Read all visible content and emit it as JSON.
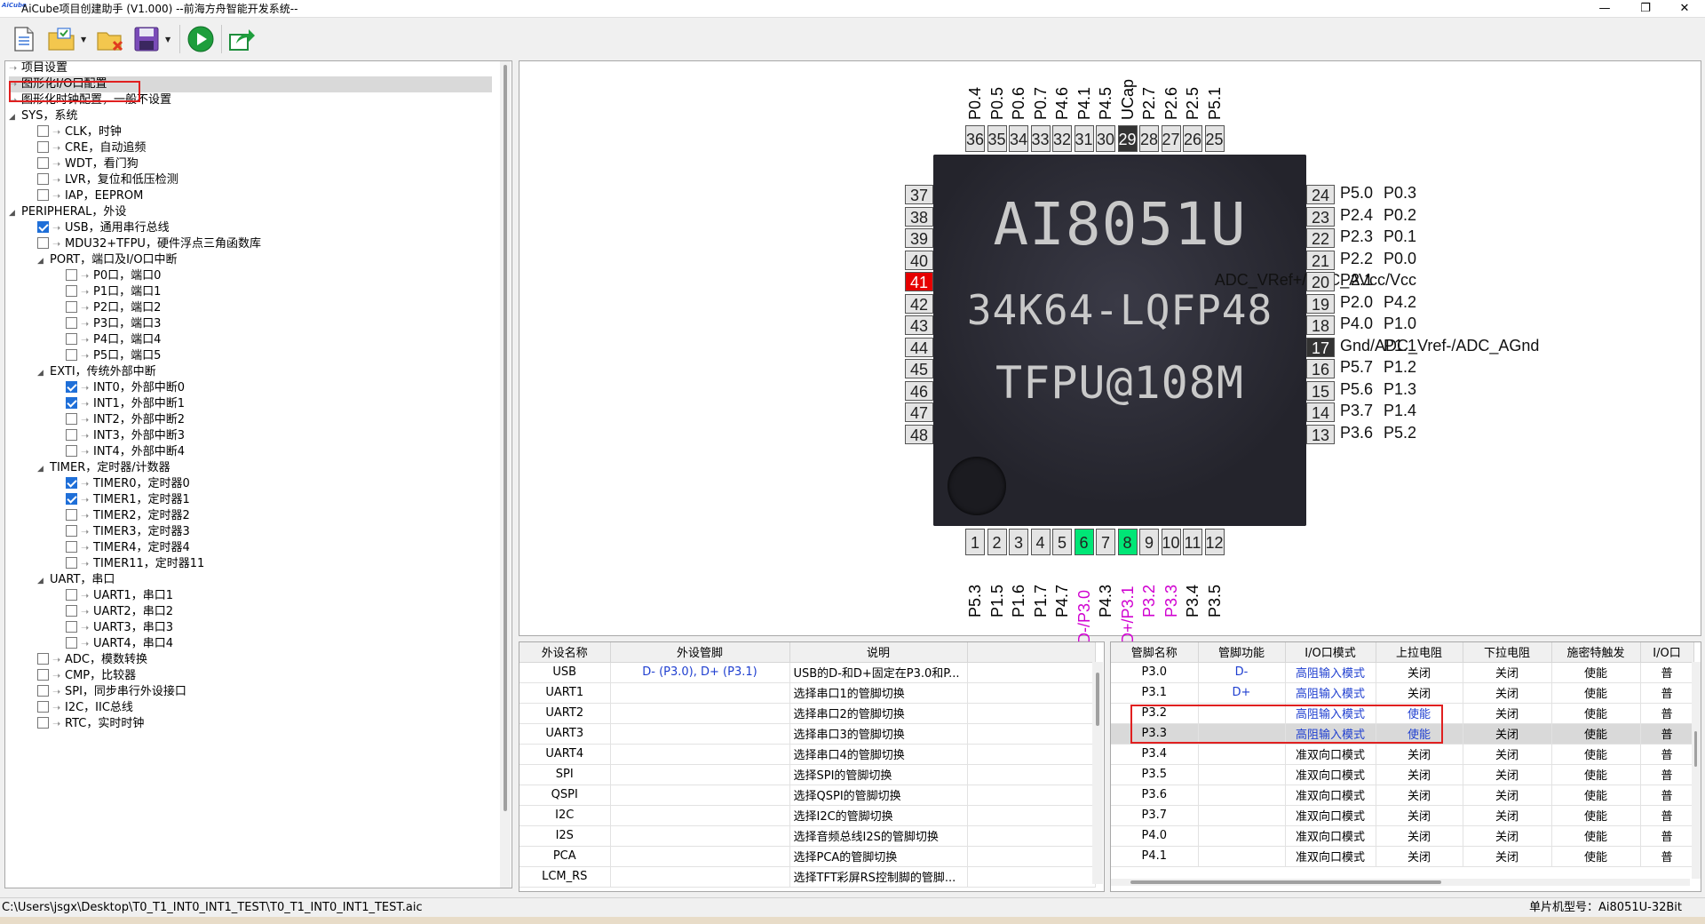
{
  "window": {
    "title": "AiCube项目创建助手 (V1.000) --前海方舟智能开发系统--",
    "logo_text": "AiCube",
    "minimize": "—",
    "restore": "❐",
    "close": "✕"
  },
  "toolbar": {
    "buttons": [
      "new-project",
      "open-project",
      "close-project",
      "save-project",
      "run",
      "export"
    ]
  },
  "tree": {
    "items": [
      {
        "label": "项目设置",
        "level": 0,
        "type": "leaf"
      },
      {
        "label": "图形化I/O口配置",
        "level": 0,
        "type": "leaf",
        "selected": true
      },
      {
        "label": "图形化时钟配置，一般不设置",
        "level": 0,
        "type": "leaf"
      },
      {
        "label": "SYS，系统",
        "level": 0,
        "type": "group"
      },
      {
        "label": "CLK，时钟",
        "level": 1,
        "type": "check",
        "checked": false
      },
      {
        "label": "CRE，自动追频",
        "level": 1,
        "type": "check",
        "checked": false
      },
      {
        "label": "WDT，看门狗",
        "level": 1,
        "type": "check",
        "checked": false
      },
      {
        "label": "LVR，复位和低压检测",
        "level": 1,
        "type": "check",
        "checked": false
      },
      {
        "label": "IAP，EEPROM",
        "level": 1,
        "type": "check",
        "checked": false
      },
      {
        "label": "PERIPHERAL，外设",
        "level": 0,
        "type": "group"
      },
      {
        "label": "USB，通用串行总线",
        "level": 1,
        "type": "check",
        "checked": true
      },
      {
        "label": "MDU32+TFPU，硬件浮点三角函数库",
        "level": 1,
        "type": "check",
        "checked": false
      },
      {
        "label": "PORT，端口及I/O口中断",
        "level": 1,
        "type": "group"
      },
      {
        "label": "P0口，端口0",
        "level": 2,
        "type": "check",
        "checked": false
      },
      {
        "label": "P1口，端口1",
        "level": 2,
        "type": "check",
        "checked": false
      },
      {
        "label": "P2口，端口2",
        "level": 2,
        "type": "check",
        "checked": false
      },
      {
        "label": "P3口，端口3",
        "level": 2,
        "type": "check",
        "checked": false
      },
      {
        "label": "P4口，端口4",
        "level": 2,
        "type": "check",
        "checked": false
      },
      {
        "label": "P5口，端口5",
        "level": 2,
        "type": "check",
        "checked": false
      },
      {
        "label": "EXTI，传统外部中断",
        "level": 1,
        "type": "group"
      },
      {
        "label": "INT0，外部中断0",
        "level": 2,
        "type": "check",
        "checked": true
      },
      {
        "label": "INT1，外部中断1",
        "level": 2,
        "type": "check",
        "checked": true
      },
      {
        "label": "INT2，外部中断2",
        "level": 2,
        "type": "check",
        "checked": false
      },
      {
        "label": "INT3，外部中断3",
        "level": 2,
        "type": "check",
        "checked": false
      },
      {
        "label": "INT4，外部中断4",
        "level": 2,
        "type": "check",
        "checked": false
      },
      {
        "label": "TIMER，定时器/计数器",
        "level": 1,
        "type": "group"
      },
      {
        "label": "TIMER0，定时器0",
        "level": 2,
        "type": "check",
        "checked": true
      },
      {
        "label": "TIMER1，定时器1",
        "level": 2,
        "type": "check",
        "checked": true
      },
      {
        "label": "TIMER2，定时器2",
        "level": 2,
        "type": "check",
        "checked": false
      },
      {
        "label": "TIMER3，定时器3",
        "level": 2,
        "type": "check",
        "checked": false
      },
      {
        "label": "TIMER4，定时器4",
        "level": 2,
        "type": "check",
        "checked": false
      },
      {
        "label": "TIMER11，定时器11",
        "level": 2,
        "type": "check",
        "checked": false
      },
      {
        "label": "UART，串口",
        "level": 1,
        "type": "group"
      },
      {
        "label": "UART1，串口1",
        "level": 2,
        "type": "check",
        "checked": false
      },
      {
        "label": "UART2，串口2",
        "level": 2,
        "type": "check",
        "checked": false
      },
      {
        "label": "UART3，串口3",
        "level": 2,
        "type": "check",
        "checked": false
      },
      {
        "label": "UART4，串口4",
        "level": 2,
        "type": "check",
        "checked": false
      },
      {
        "label": "ADC，模数转换",
        "level": 1,
        "type": "check",
        "checked": false
      },
      {
        "label": "CMP，比较器",
        "level": 1,
        "type": "check",
        "checked": false
      },
      {
        "label": "SPI，同步串行外设接口",
        "level": 1,
        "type": "check",
        "checked": false
      },
      {
        "label": "I2C，IIC总线",
        "level": 1,
        "type": "check",
        "checked": false
      },
      {
        "label": "RTC，实时时钟",
        "level": 1,
        "type": "check",
        "checked": false
      }
    ]
  },
  "chip": {
    "line1": "AI8051U",
    "line2": "34K64-LQFP48",
    "line3": "TFPU@108M",
    "top_pins": [
      {
        "num": "36",
        "name": "P0.4"
      },
      {
        "num": "35",
        "name": "P0.5"
      },
      {
        "num": "34",
        "name": "P0.6"
      },
      {
        "num": "33",
        "name": "P0.7"
      },
      {
        "num": "32",
        "name": "P4.6"
      },
      {
        "num": "31",
        "name": "P4.1"
      },
      {
        "num": "30",
        "name": "P4.5"
      },
      {
        "num": "29",
        "name": "UCap",
        "style": "dark"
      },
      {
        "num": "28",
        "name": "P2.7"
      },
      {
        "num": "27",
        "name": "P2.6"
      },
      {
        "num": "26",
        "name": "P2.5"
      },
      {
        "num": "25",
        "name": "P5.1"
      }
    ],
    "left_pins": [
      {
        "num": "37",
        "name": "P0.3"
      },
      {
        "num": "38",
        "name": "P0.2"
      },
      {
        "num": "39",
        "name": "P0.1"
      },
      {
        "num": "40",
        "name": "P0.0"
      },
      {
        "num": "41",
        "name": "ADC_VRef+/ADC_AVcc/Vcc",
        "style": "red"
      },
      {
        "num": "42",
        "name": "P4.2"
      },
      {
        "num": "43",
        "name": "P1.0"
      },
      {
        "num": "44",
        "name": "P1.1"
      },
      {
        "num": "45",
        "name": "P1.2"
      },
      {
        "num": "46",
        "name": "P1.3"
      },
      {
        "num": "47",
        "name": "P1.4"
      },
      {
        "num": "48",
        "name": "P5.2"
      }
    ],
    "right_pins": [
      {
        "num": "24",
        "name": "P5.0"
      },
      {
        "num": "23",
        "name": "P2.4"
      },
      {
        "num": "22",
        "name": "P2.3"
      },
      {
        "num": "21",
        "name": "P2.2"
      },
      {
        "num": "20",
        "name": "P2.1"
      },
      {
        "num": "19",
        "name": "P2.0"
      },
      {
        "num": "18",
        "name": "P4.0"
      },
      {
        "num": "17",
        "name": "Gnd/ADC_Vref-/ADC_AGnd",
        "style": "dark"
      },
      {
        "num": "16",
        "name": "P5.7"
      },
      {
        "num": "15",
        "name": "P5.6"
      },
      {
        "num": "14",
        "name": "P3.7"
      },
      {
        "num": "13",
        "name": "P3.6"
      }
    ],
    "bottom_pins": [
      {
        "num": "1",
        "name": "P5.3"
      },
      {
        "num": "2",
        "name": "P1.5"
      },
      {
        "num": "3",
        "name": "P1.6"
      },
      {
        "num": "4",
        "name": "P1.7"
      },
      {
        "num": "5",
        "name": "P4.7"
      },
      {
        "num": "6",
        "name": "D-/P3.0",
        "style": "green",
        "label": "magenta"
      },
      {
        "num": "7",
        "name": "P4.3"
      },
      {
        "num": "8",
        "name": "D+/P3.1",
        "style": "green",
        "label": "magenta"
      },
      {
        "num": "9",
        "name": "P3.2",
        "label": "magenta"
      },
      {
        "num": "10",
        "name": "P3.3",
        "label": "magenta"
      },
      {
        "num": "11",
        "name": "P3.4"
      },
      {
        "num": "12",
        "name": "P3.5"
      }
    ]
  },
  "periph_table": {
    "headers": [
      "外设名称",
      "外设管脚",
      "说明"
    ],
    "rows": [
      [
        "USB",
        "D- (P3.0), D+ (P3.1)",
        "USB的D-和D+固定在P3.0和P..."
      ],
      [
        "UART1",
        "",
        "选择串口1的管脚切换"
      ],
      [
        "UART2",
        "",
        "选择串口2的管脚切换"
      ],
      [
        "UART3",
        "",
        "选择串口3的管脚切换"
      ],
      [
        "UART4",
        "",
        "选择串口4的管脚切换"
      ],
      [
        "SPI",
        "",
        "选择SPI的管脚切换"
      ],
      [
        "QSPI",
        "",
        "选择QSPI的管脚切换"
      ],
      [
        "I2C",
        "",
        "选择I2C的管脚切换"
      ],
      [
        "I2S",
        "",
        "选择音频总线I2S的管脚切换"
      ],
      [
        "PCA",
        "",
        "选择PCA的管脚切换"
      ],
      [
        "LCM_RS",
        "",
        "选择TFT彩屏RS控制脚的管脚..."
      ]
    ]
  },
  "pin_table": {
    "headers": [
      "管脚名称",
      "管脚功能",
      "I/O口模式",
      "上拉电阻",
      "下拉电阻",
      "施密特触发",
      "I/O口"
    ],
    "rows": [
      {
        "cells": [
          "P3.0",
          "D-",
          "高阻输入模式",
          "关闭",
          "关闭",
          "使能",
          "普"
        ],
        "blue": [
          1,
          2
        ]
      },
      {
        "cells": [
          "P3.1",
          "D+",
          "高阻输入模式",
          "关闭",
          "关闭",
          "使能",
          "普"
        ],
        "blue": [
          1,
          2
        ]
      },
      {
        "cells": [
          "P3.2",
          "",
          "高阻输入模式",
          "使能",
          "关闭",
          "使能",
          "普"
        ],
        "blue": [
          2,
          3
        ]
      },
      {
        "cells": [
          "P3.3",
          "",
          "高阻输入模式",
          "使能",
          "关闭",
          "使能",
          "普"
        ],
        "blue": [
          2,
          3
        ],
        "selected": true
      },
      {
        "cells": [
          "P3.4",
          "",
          "准双向口模式",
          "关闭",
          "关闭",
          "使能",
          "普"
        ],
        "blue": []
      },
      {
        "cells": [
          "P3.5",
          "",
          "准双向口模式",
          "关闭",
          "关闭",
          "使能",
          "普"
        ],
        "blue": []
      },
      {
        "cells": [
          "P3.6",
          "",
          "准双向口模式",
          "关闭",
          "关闭",
          "使能",
          "普"
        ],
        "blue": []
      },
      {
        "cells": [
          "P3.7",
          "",
          "准双向口模式",
          "关闭",
          "关闭",
          "使能",
          "普"
        ],
        "blue": []
      },
      {
        "cells": [
          "P4.0",
          "",
          "准双向口模式",
          "关闭",
          "关闭",
          "使能",
          "普"
        ],
        "blue": []
      },
      {
        "cells": [
          "P4.1",
          "",
          "准双向口模式",
          "关闭",
          "关闭",
          "使能",
          "普"
        ],
        "blue": []
      }
    ]
  },
  "status": {
    "path": "C:\\Users\\jsgx\\Desktop\\T0_T1_INT0_INT1_TEST\\T0_T1_INT0_INT1_TEST.aic",
    "mcu_label": "单片机型号：Ai8051U-32Bit"
  },
  "colors": {
    "accent_blue": "#1f3fd0",
    "highlight_red": "#e02020",
    "pin_green": "#00e676",
    "pin_red": "#e60000",
    "label_magenta": "#d000d0"
  }
}
